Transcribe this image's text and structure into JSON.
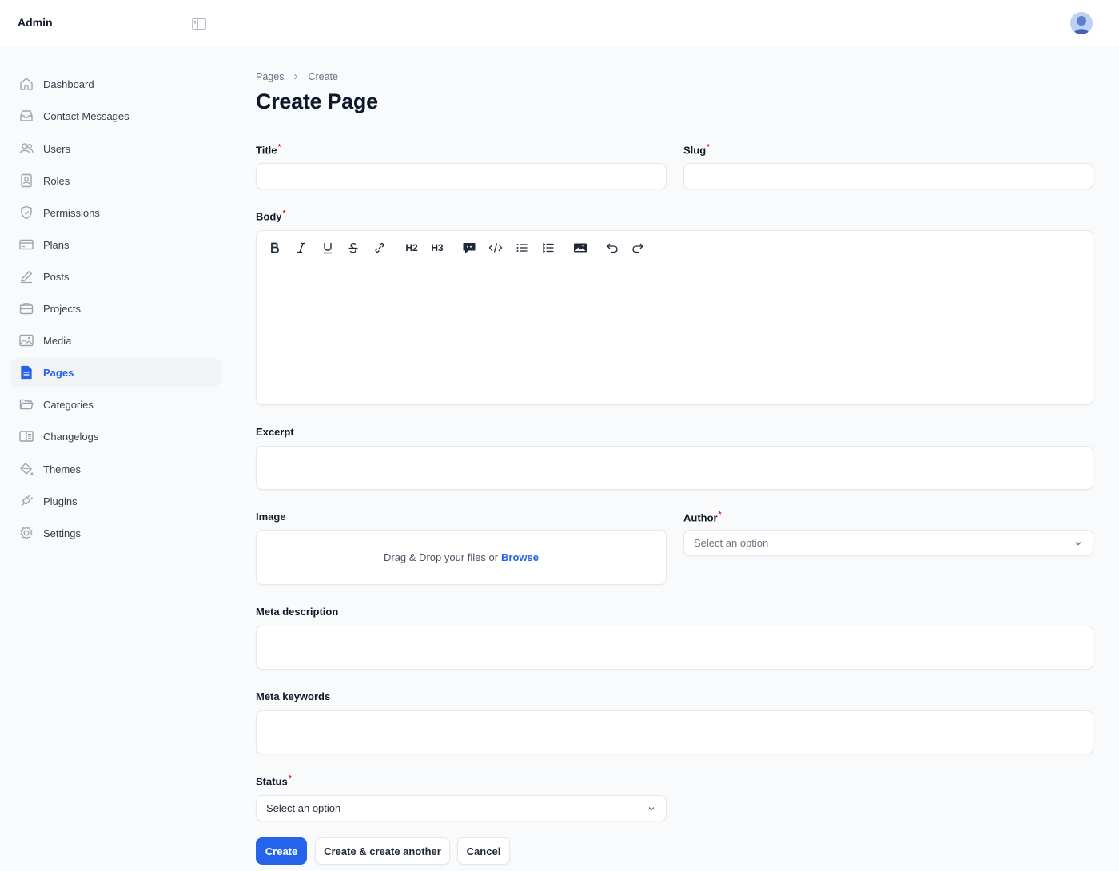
{
  "header": {
    "brand": "Admin"
  },
  "sidebar": {
    "items": [
      {
        "label": "Dashboard",
        "icon": "home-icon"
      },
      {
        "label": "Contact Messages",
        "icon": "inbox-icon"
      },
      {
        "label": "Users",
        "icon": "users-icon"
      },
      {
        "label": "Roles",
        "icon": "user-badge-icon"
      },
      {
        "label": "Permissions",
        "icon": "shield-check-icon"
      },
      {
        "label": "Plans",
        "icon": "credit-card-icon"
      },
      {
        "label": "Posts",
        "icon": "pencil-icon"
      },
      {
        "label": "Projects",
        "icon": "briefcase-icon"
      },
      {
        "label": "Media",
        "icon": "photo-icon"
      },
      {
        "label": "Pages",
        "icon": "document-icon",
        "active": true
      },
      {
        "label": "Categories",
        "icon": "folder-open-icon"
      },
      {
        "label": "Changelogs",
        "icon": "book-open-icon"
      },
      {
        "label": "Themes",
        "icon": "paint-bucket-icon"
      },
      {
        "label": "Plugins",
        "icon": "plug-icon"
      },
      {
        "label": "Settings",
        "icon": "gear-icon"
      }
    ]
  },
  "breadcrumb": {
    "parent": "Pages",
    "separator": ">",
    "current": "Create"
  },
  "page": {
    "title": "Create Page"
  },
  "form": {
    "title_label": "Title",
    "title_value": "",
    "slug_label": "Slug",
    "slug_value": "",
    "body_label": "Body",
    "body_value": "",
    "excerpt_label": "Excerpt",
    "excerpt_value": "",
    "image_label": "Image",
    "image_dropzone_text": "Drag & Drop your files or",
    "image_browse": "Browse",
    "author_label": "Author",
    "author_placeholder": "Select an option",
    "meta_description_label": "Meta description",
    "meta_description_value": "",
    "meta_keywords_label": "Meta keywords",
    "meta_keywords_value": "",
    "status_label": "Status",
    "status_value": "Select an option",
    "required_marker": "*"
  },
  "toolbar": {
    "h2": "H2",
    "h3": "H3"
  },
  "actions": {
    "create": "Create",
    "create_another": "Create & create another",
    "cancel": "Cancel"
  },
  "colors": {
    "accent": "#2563eb",
    "required": "#dc2626",
    "background": "#f9fafb"
  }
}
